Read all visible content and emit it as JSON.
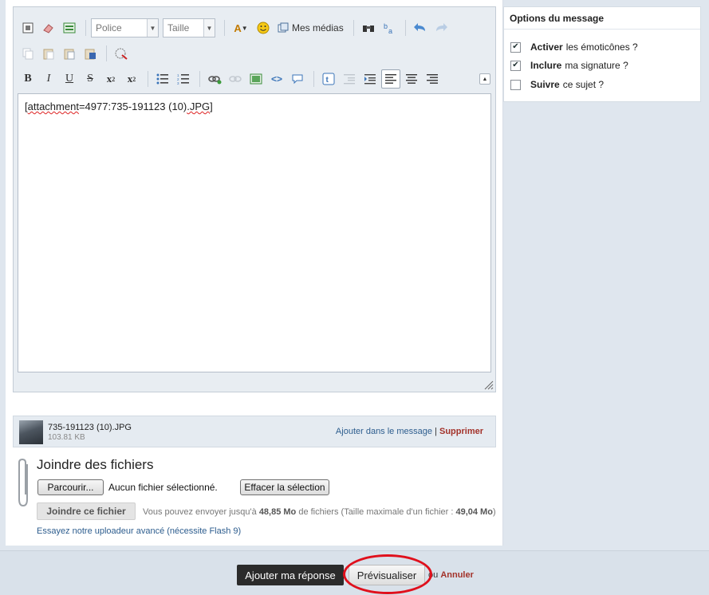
{
  "toolbar": {
    "font_placeholder": "Police",
    "size_placeholder": "Taille",
    "media_label": "Mes médias"
  },
  "editor": {
    "content": "[attachment=4977:735-191123 (10).JPG]",
    "content_prefix": "[",
    "content_spell": "attachment",
    "content_mid": "=4977:735-191123 (10)",
    "content_spell2": ".JPG",
    "content_suffix": "]"
  },
  "attachment": {
    "filename": "735-191123 (10).JPG",
    "size": "103.81 KB",
    "insert_link": "Ajouter dans le message",
    "separator": "|",
    "delete_link": "Supprimer"
  },
  "upload": {
    "title": "Joindre des fichiers",
    "browse_button": "Parcourir...",
    "no_file": "Aucun fichier sélectionné.",
    "clear_button": "Effacer la sélection",
    "attach_button": "Joindre ce fichier",
    "limit_prefix": "Vous pouvez envoyer jusqu'à ",
    "limit_total": "48,85 Mo",
    "limit_mid": " de fichiers (Taille maximale d'un fichier : ",
    "limit_file": "49,04 Mo",
    "limit_suffix": ")",
    "advanced_link": "Essayez notre uploadeur avancé (nécessite Flash 9)"
  },
  "options": {
    "title": "Options du message",
    "items": [
      {
        "bold": "Activer",
        "rest": "les émoticônes ?",
        "checked": true
      },
      {
        "bold": "Inclure",
        "rest": "ma signature ?",
        "checked": true
      },
      {
        "bold": "Suivre",
        "rest": "ce sujet ?",
        "checked": false
      }
    ]
  },
  "footer": {
    "submit_button": "Ajouter ma réponse",
    "preview_button": "Prévisualiser",
    "or_text": "ou",
    "cancel_link": "Annuler"
  },
  "colors": {
    "annotation_ring": "#e0101c",
    "link": "#2d5d8e",
    "danger_link": "#a3322a"
  }
}
